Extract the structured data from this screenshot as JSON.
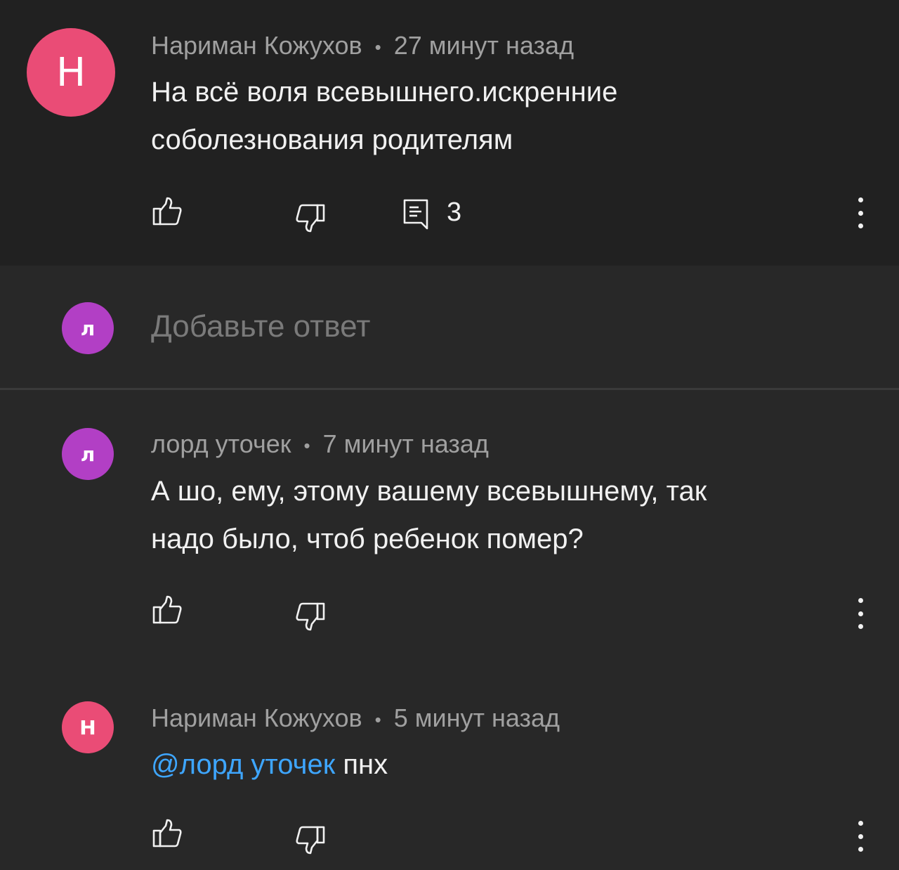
{
  "main_comment": {
    "avatar_letter": "Н",
    "author": "Нариман Кожухов",
    "time": "27 минут назад",
    "text_line1": "На всё воля всевышнего.искренние",
    "text_line2": "соболезнования родителям",
    "reply_count": "3"
  },
  "reply_box": {
    "avatar_letter": "л",
    "placeholder": "Добавьте ответ"
  },
  "replies": [
    {
      "avatar_letter": "л",
      "author": "лорд уточек",
      "time": "7 минут назад",
      "text_line1": "А шо, ему, этому вашему всевышнему, так",
      "text_line2": "надо было, чтоб ребенок помер?"
    },
    {
      "avatar_letter": "Н",
      "author": "Нариман Кожухов",
      "time": "5 минут назад",
      "mention": "@лорд уточек",
      "text": " пнх"
    }
  ],
  "separator": "•",
  "icons": [
    "thumb-up-icon",
    "thumb-down-icon",
    "reply-icon",
    "more-vert-icon"
  ],
  "colors": {
    "background": "#282828",
    "top_background": "#212121",
    "avatar_pink": "#ea4c76",
    "avatar_purple": "#b23fc5",
    "mention": "#3ea6ff"
  }
}
